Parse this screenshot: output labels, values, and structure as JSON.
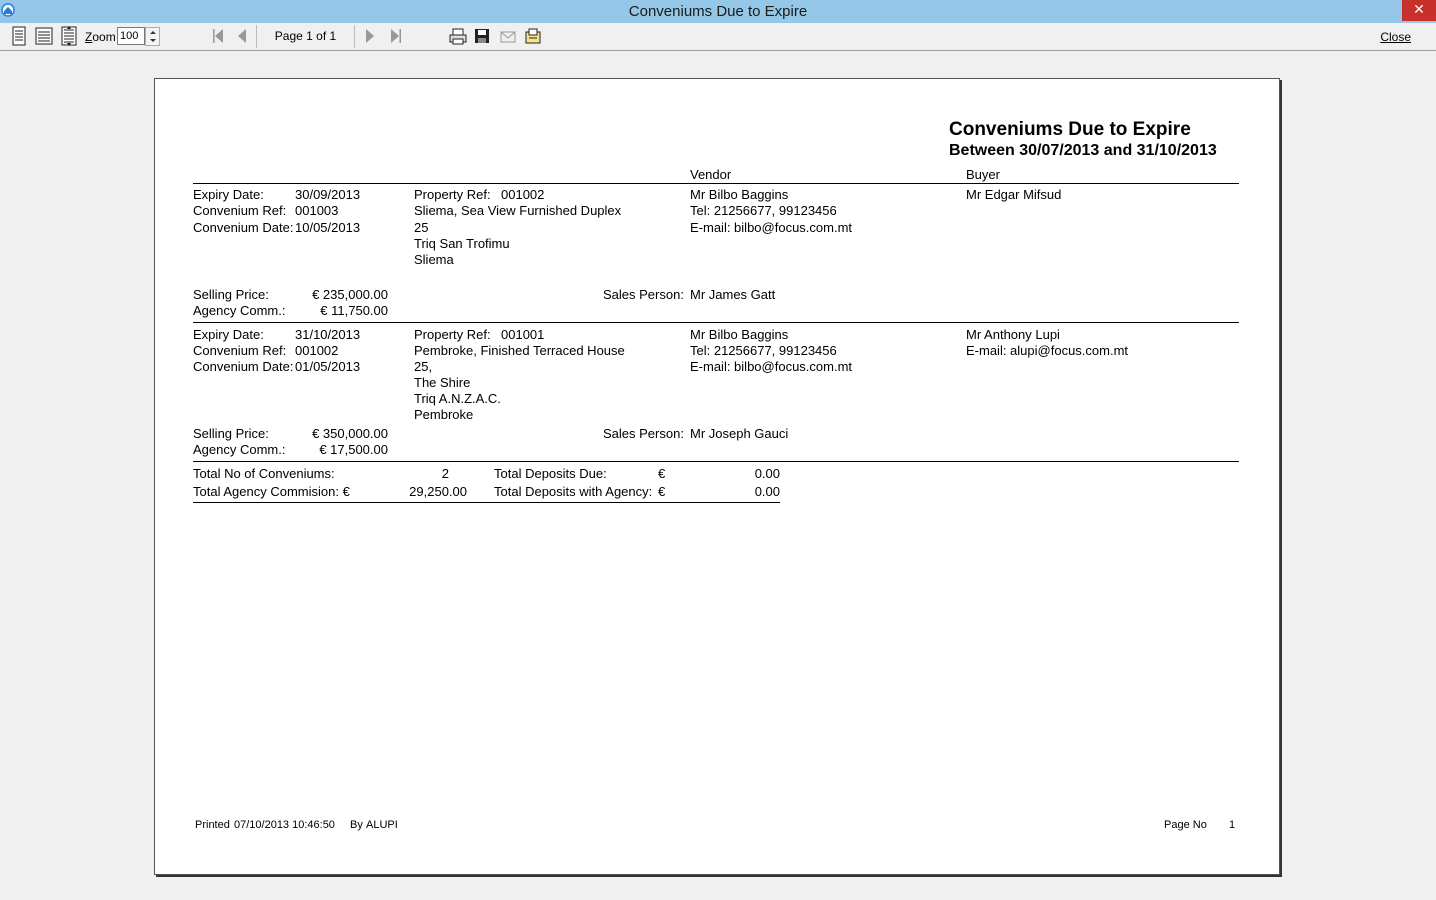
{
  "window": {
    "title": "Conveniums Due to Expire",
    "close_glyph": "✕"
  },
  "toolbar": {
    "zoom_label_prefix": "Z",
    "zoom_label_rest": "oom",
    "zoom_value": "100",
    "page_text": "Page 1 of 1",
    "close_label": "Close"
  },
  "report": {
    "title": "Conveniums Due to Expire",
    "subtitle": "Between 30/07/2013 and 31/10/2013",
    "col_vendor": "Vendor",
    "col_buyer": "Buyer",
    "lbl_expiry": "Expiry Date:",
    "lbl_convref": "Convenium Ref:",
    "lbl_convdate": "Convenium Date:",
    "lbl_propref": "Property Ref:",
    "lbl_selling": "Selling Price:",
    "lbl_agency": "Agency Comm.:",
    "lbl_salesperson": "Sales Person:",
    "records": [
      {
        "expiry": "30/09/2013",
        "convref": "001003",
        "convdate": "10/05/2013",
        "propref": "001002",
        "address": [
          "Sliema, Sea View Furnished Duplex",
          "25",
          "Triq San Trofimu",
          "Sliema"
        ],
        "vendor": [
          "Mr Bilbo Baggins",
          "Tel: 21256677, 99123456",
          "E-mail: bilbo@focus.com.mt"
        ],
        "buyer": [
          "Mr Edgar Mifsud"
        ],
        "selling": "€ 235,000.00",
        "agency": "€ 11,750.00",
        "salesperson": "Mr James Gatt"
      },
      {
        "expiry": "31/10/2013",
        "convref": "001002",
        "convdate": "01/05/2013",
        "propref": "001001",
        "address": [
          "Pembroke, Finished Terraced House",
          "25,",
          "The Shire",
          "Triq A.N.Z.A.C.",
          "Pembroke"
        ],
        "vendor": [
          "Mr Bilbo Baggins",
          "Tel: 21256677, 99123456",
          "E-mail: bilbo@focus.com.mt"
        ],
        "buyer": [
          "Mr Anthony Lupi",
          "E-mail: alupi@focus.com.mt"
        ],
        "selling": "€ 350,000.00",
        "agency": "€ 17,500.00",
        "salesperson": "Mr Joseph Gauci"
      }
    ],
    "totals": {
      "lbl_count": "Total No of Conveniums:",
      "count": "2",
      "lbl_commission": "Total Agency Commision: €",
      "commission": "29,250.00",
      "lbl_deposits_due": "Total Deposits Due:",
      "deposits_due_currency": "€",
      "deposits_due": "0.00",
      "lbl_deposits_agency": "Total Deposits with Agency:",
      "deposits_agency_currency": "€",
      "deposits_agency": "0.00"
    },
    "footer": {
      "printed_label": "Printed",
      "printed_value": "07/10/2013 10:46:50",
      "by_label": "By",
      "by_value": "ALUPI",
      "page_label": "Page No",
      "page_value": "1"
    }
  },
  "icons": [
    "app-icon",
    "single-page-icon",
    "page-width-icon",
    "full-page-icon",
    "first-page-icon",
    "prev-page-icon",
    "next-page-icon",
    "last-page-icon",
    "print-icon",
    "save-icon",
    "email-icon",
    "export-icon"
  ]
}
